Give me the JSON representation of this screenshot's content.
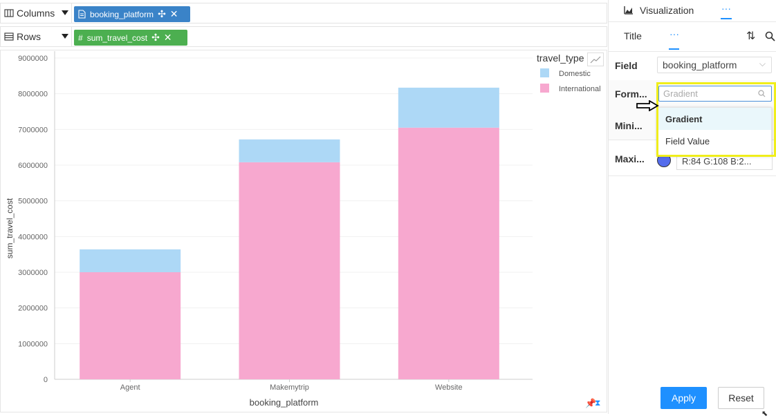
{
  "shelves": {
    "columns_label": "Columns",
    "rows_label": "Rows",
    "columns_pill": "booking_platform",
    "rows_pill": "sum_travel_cost",
    "columns_pill_color": "#3a83c8",
    "rows_pill_color": "#4caf50",
    "rows_pill_hash": "#"
  },
  "legend": {
    "title": "travel_type",
    "items": [
      "Domestic",
      "International"
    ]
  },
  "panel": {
    "tab_visualization": "Visualization",
    "tab_more": "···",
    "subtab_title": "Title",
    "subtab_more": "···",
    "field_label": "Field",
    "field_value": "booking_platform",
    "format_label": "Form...",
    "format_placeholder": "Gradient",
    "minimum_label": "Mini...",
    "maximum_label": "Maxi...",
    "maximum_color_value": "R:84 G:108 B:2...",
    "maximum_color": "#546cec",
    "dropdown_options": [
      "Gradient",
      "Field Value"
    ],
    "apply_label": "Apply",
    "reset_label": "Reset"
  },
  "colors": {
    "domestic": "#add8f6",
    "international": "#f7a8cf",
    "highlight": "#f0ee1a",
    "apply": "#1e90ff"
  },
  "chart_data": {
    "type": "bar",
    "stacked": true,
    "categories": [
      "Agent",
      "Makemytrip",
      "Website"
    ],
    "series": [
      {
        "name": "International",
        "values": [
          3000000,
          6080000,
          7050000
        ]
      },
      {
        "name": "Domestic",
        "values": [
          640000,
          640000,
          1120000
        ]
      }
    ],
    "xlabel": "booking_platform",
    "ylabel": "sum_travel_cost",
    "ylim": [
      0,
      9000000
    ],
    "yticks": [
      "0",
      "1000000",
      "2000000",
      "3000000",
      "4000000",
      "5000000",
      "6000000",
      "7000000",
      "8000000",
      "9000000"
    ],
    "legend_position": "top-right",
    "grid": true
  }
}
